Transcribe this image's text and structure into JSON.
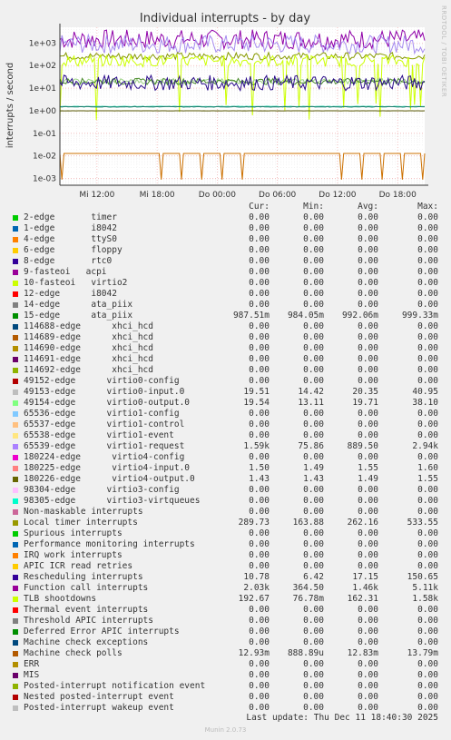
{
  "chart_data": {
    "type": "line",
    "title": "Individual interrupts - by day",
    "ylabel": "interrupts / second",
    "yscale": "log",
    "ylim": [
      0.0005,
      5000
    ],
    "y_ticks": [
      {
        "value": 1000,
        "label": "1e+03"
      },
      {
        "value": 100,
        "label": "1e+02"
      },
      {
        "value": 10,
        "label": "1e+01"
      },
      {
        "value": 1,
        "label": "1e+00"
      },
      {
        "value": 0.1,
        "label": "1e-01"
      },
      {
        "value": 0.01,
        "label": "1e-02"
      },
      {
        "value": 0.001,
        "label": "1e-03"
      }
    ],
    "x_ticks": [
      "Mi 12:00",
      "Mi 18:00",
      "Do 00:00",
      "Do 06:00",
      "Do 12:00",
      "Do 18:00"
    ],
    "x_tick_hours": [
      12,
      18,
      24,
      30,
      36,
      42
    ],
    "x_range_hours": [
      8.3,
      44.7
    ],
    "grid": true,
    "series": [
      {
        "name": "Function call interrupts",
        "color": "#8f00a8",
        "avg": 1460,
        "min": 364.5,
        "max": 5110
      },
      {
        "name": "virtio1-request",
        "color": "#a68bf0",
        "avg": 889.5,
        "min": 75.86,
        "max": 2940
      },
      {
        "name": "Local timer interrupts",
        "color": "#889a00",
        "avg": 262.16,
        "min": 163.88,
        "max": 533.55
      },
      {
        "name": "TLB shootdowns",
        "color": "#ccff00",
        "avg": 162.31,
        "min": 76.78,
        "max": 1580
      },
      {
        "name": "virtio0-input.0",
        "color": "#98d080",
        "avg": 20.35,
        "min": 14.42,
        "max": 40.95
      },
      {
        "name": "virtio0-output.0",
        "color": "#4a8a2a",
        "avg": 19.71,
        "min": 13.11,
        "max": 38.1
      },
      {
        "name": "Rescheduling interrupts",
        "color": "#2a0a8a",
        "avg": 17.15,
        "min": 6.42,
        "max": 150.65
      },
      {
        "name": "virtio4-input.0",
        "color": "#39d9b4",
        "avg": 1.55,
        "min": 1.49,
        "max": 1.6
      },
      {
        "name": "virtio4-output.0",
        "color": "#1a7a6a",
        "avg": 1.49,
        "min": 1.43,
        "max": 1.55
      },
      {
        "name": "15-edge",
        "color": "#555500",
        "avg": 0.99206,
        "min": 0.98405,
        "max": 0.99933
      },
      {
        "name": "Machine check polls",
        "color": "#cc7000",
        "avg": 0.01283,
        "min": 0.000888,
        "max": 0.01379
      }
    ]
  },
  "side_label": "RRDTOOL / TOBI OETIKER",
  "legend": {
    "headers": {
      "cur": "Cur:",
      "min": "Min:",
      "avg": "Avg:",
      "max": "Max:"
    },
    "rows": [
      {
        "color": "#00cc00",
        "name": "2-edge       timer",
        "cur": "0.00",
        "min": "0.00",
        "avg": "0.00",
        "max": "0.00"
      },
      {
        "color": "#0066b3",
        "name": "1-edge       i8042",
        "cur": "0.00",
        "min": "0.00",
        "avg": "0.00",
        "max": "0.00"
      },
      {
        "color": "#ff8000",
        "name": "4-edge       ttyS0",
        "cur": "0.00",
        "min": "0.00",
        "avg": "0.00",
        "max": "0.00"
      },
      {
        "color": "#ffcc00",
        "name": "6-edge       floppy",
        "cur": "0.00",
        "min": "0.00",
        "avg": "0.00",
        "max": "0.00"
      },
      {
        "color": "#330099",
        "name": "8-edge       rtc0",
        "cur": "0.00",
        "min": "0.00",
        "avg": "0.00",
        "max": "0.00"
      },
      {
        "color": "#990099",
        "name": "9-fasteoi   acpi",
        "cur": "0.00",
        "min": "0.00",
        "avg": "0.00",
        "max": "0.00"
      },
      {
        "color": "#ccff00",
        "name": "10-fasteoi   virtio2",
        "cur": "0.00",
        "min": "0.00",
        "avg": "0.00",
        "max": "0.00"
      },
      {
        "color": "#ff0000",
        "name": "12-edge      i8042",
        "cur": "0.00",
        "min": "0.00",
        "avg": "0.00",
        "max": "0.00"
      },
      {
        "color": "#808080",
        "name": "14-edge      ata_piix",
        "cur": "0.00",
        "min": "0.00",
        "avg": "0.00",
        "max": "0.00"
      },
      {
        "color": "#008f00",
        "name": "15-edge      ata_piix",
        "cur": "987.51m",
        "min": "984.05m",
        "avg": "992.06m",
        "max": "999.33m"
      },
      {
        "color": "#00487d",
        "name": "114688-edge      xhci_hcd",
        "cur": "0.00",
        "min": "0.00",
        "avg": "0.00",
        "max": "0.00"
      },
      {
        "color": "#b35a00",
        "name": "114689-edge      xhci_hcd",
        "cur": "0.00",
        "min": "0.00",
        "avg": "0.00",
        "max": "0.00"
      },
      {
        "color": "#b38f00",
        "name": "114690-edge      xhci_hcd",
        "cur": "0.00",
        "min": "0.00",
        "avg": "0.00",
        "max": "0.00"
      },
      {
        "color": "#6b006b",
        "name": "114691-edge      xhci_hcd",
        "cur": "0.00",
        "min": "0.00",
        "avg": "0.00",
        "max": "0.00"
      },
      {
        "color": "#8fb300",
        "name": "114692-edge      xhci_hcd",
        "cur": "0.00",
        "min": "0.00",
        "avg": "0.00",
        "max": "0.00"
      },
      {
        "color": "#b30000",
        "name": "49152-edge      virtio0-config",
        "cur": "0.00",
        "min": "0.00",
        "avg": "0.00",
        "max": "0.00"
      },
      {
        "color": "#bebebe",
        "name": "49153-edge      virtio0-input.0",
        "cur": "19.51",
        "min": "14.42",
        "avg": "20.35",
        "max": "40.95"
      },
      {
        "color": "#80ff80",
        "name": "49154-edge      virtio0-output.0",
        "cur": "19.54",
        "min": "13.11",
        "avg": "19.71",
        "max": "38.10"
      },
      {
        "color": "#80c9ff",
        "name": "65536-edge      virtio1-config",
        "cur": "0.00",
        "min": "0.00",
        "avg": "0.00",
        "max": "0.00"
      },
      {
        "color": "#ffc080",
        "name": "65537-edge      virtio1-control",
        "cur": "0.00",
        "min": "0.00",
        "avg": "0.00",
        "max": "0.00"
      },
      {
        "color": "#ffe680",
        "name": "65538-edge      virtio1-event",
        "cur": "0.00",
        "min": "0.00",
        "avg": "0.00",
        "max": "0.00"
      },
      {
        "color": "#aa80ff",
        "name": "65539-edge      virtio1-request",
        "cur": "1.59k",
        "min": "75.86",
        "avg": "889.50",
        "max": "2.94k"
      },
      {
        "color": "#ee00cc",
        "name": "180224-edge      virtio4-config",
        "cur": "0.00",
        "min": "0.00",
        "avg": "0.00",
        "max": "0.00"
      },
      {
        "color": "#ff8080",
        "name": "180225-edge      virtio4-input.0",
        "cur": "1.50",
        "min": "1.49",
        "avg": "1.55",
        "max": "1.60"
      },
      {
        "color": "#666600",
        "name": "180226-edge      virtio4-output.0",
        "cur": "1.43",
        "min": "1.43",
        "avg": "1.49",
        "max": "1.55"
      },
      {
        "color": "#ffbfff",
        "name": "98304-edge      virtio3-config",
        "cur": "0.00",
        "min": "0.00",
        "avg": "0.00",
        "max": "0.00"
      },
      {
        "color": "#00ffcc",
        "name": "98305-edge      virtio3-virtqueues",
        "cur": "0.00",
        "min": "0.00",
        "avg": "0.00",
        "max": "0.00"
      },
      {
        "color": "#cc6699",
        "name": "Non-maskable interrupts",
        "cur": "0.00",
        "min": "0.00",
        "avg": "0.00",
        "max": "0.00"
      },
      {
        "color": "#999900",
        "name": "Local timer interrupts",
        "cur": "289.73",
        "min": "163.88",
        "avg": "262.16",
        "max": "533.55"
      },
      {
        "color": "#00cc00",
        "name": "Spurious interrupts",
        "cur": "0.00",
        "min": "0.00",
        "avg": "0.00",
        "max": "0.00"
      },
      {
        "color": "#0066b3",
        "name": "Performance monitoring interrupts",
        "cur": "0.00",
        "min": "0.00",
        "avg": "0.00",
        "max": "0.00"
      },
      {
        "color": "#ff8000",
        "name": "IRQ work interrupts",
        "cur": "0.00",
        "min": "0.00",
        "avg": "0.00",
        "max": "0.00"
      },
      {
        "color": "#ffcc00",
        "name": "APIC ICR read retries",
        "cur": "0.00",
        "min": "0.00",
        "avg": "0.00",
        "max": "0.00"
      },
      {
        "color": "#330099",
        "name": "Rescheduling interrupts",
        "cur": "10.78",
        "min": "6.42",
        "avg": "17.15",
        "max": "150.65"
      },
      {
        "color": "#990099",
        "name": "Function call interrupts",
        "cur": "2.03k",
        "min": "364.50",
        "avg": "1.46k",
        "max": "5.11k"
      },
      {
        "color": "#ccff00",
        "name": "TLB shootdowns",
        "cur": "192.67",
        "min": "76.78m",
        "avg": "162.31",
        "max": "1.58k"
      },
      {
        "color": "#ff0000",
        "name": "Thermal event interrupts",
        "cur": "0.00",
        "min": "0.00",
        "avg": "0.00",
        "max": "0.00"
      },
      {
        "color": "#808080",
        "name": "Threshold APIC interrupts",
        "cur": "0.00",
        "min": "0.00",
        "avg": "0.00",
        "max": "0.00"
      },
      {
        "color": "#008f00",
        "name": "Deferred Error APIC interrupts",
        "cur": "0.00",
        "min": "0.00",
        "avg": "0.00",
        "max": "0.00"
      },
      {
        "color": "#00487d",
        "name": "Machine check exceptions",
        "cur": "0.00",
        "min": "0.00",
        "avg": "0.00",
        "max": "0.00"
      },
      {
        "color": "#b35a00",
        "name": "Machine check polls",
        "cur": "12.93m",
        "min": "888.89u",
        "avg": "12.83m",
        "max": "13.79m"
      },
      {
        "color": "#b38f00",
        "name": "ERR",
        "cur": "0.00",
        "min": "0.00",
        "avg": "0.00",
        "max": "0.00"
      },
      {
        "color": "#6b006b",
        "name": "MIS",
        "cur": "0.00",
        "min": "0.00",
        "avg": "0.00",
        "max": "0.00"
      },
      {
        "color": "#8fb300",
        "name": "Posted-interrupt notification event",
        "cur": "0.00",
        "min": "0.00",
        "avg": "0.00",
        "max": "0.00"
      },
      {
        "color": "#b30000",
        "name": "Nested posted-interrupt event",
        "cur": "0.00",
        "min": "0.00",
        "avg": "0.00",
        "max": "0.00"
      },
      {
        "color": "#bebebe",
        "name": "Posted-interrupt wakeup event",
        "cur": "0.00",
        "min": "0.00",
        "avg": "0.00",
        "max": "0.00"
      }
    ]
  },
  "footer": {
    "last_update": "Last update: Thu Dec 11 18:40:30 2025"
  },
  "munin_version": "Munin 2.0.73"
}
